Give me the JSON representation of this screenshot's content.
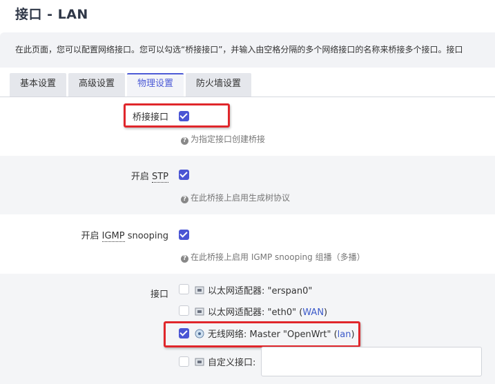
{
  "page": {
    "title": "接口 - LAN",
    "description": "在此页面，您可以配置网络接口。您可以勾选“桥接接口”，并输入由空格分隔的多个网络接口的名称来桥接多个接口。接口"
  },
  "tabs": [
    {
      "label": "基本设置",
      "active": false
    },
    {
      "label": "高级设置",
      "active": false
    },
    {
      "label": "物理设置",
      "active": true
    },
    {
      "label": "防火墙设置",
      "active": false
    }
  ],
  "fields": {
    "bridge": {
      "label": "桥接接口",
      "checked": true,
      "hint": "为指定接口创建桥接"
    },
    "stp": {
      "label_prefix": "开启 ",
      "abbr": "STP",
      "checked": true,
      "hint": "在此桥接上启用生成树协议"
    },
    "igmp": {
      "label_prefix": "开启 ",
      "abbr": "IGMP",
      "label_suffix": " snooping",
      "checked": true,
      "hint": "在此桥接上启用 IGMP snooping 组播（多播）"
    },
    "interfaces": {
      "label": "接口",
      "options": [
        {
          "text": "以太网适配器: \"erspan0\"",
          "link": "",
          "suffix": "",
          "checked": false
        },
        {
          "text": "以太网适配器: \"eth0\" (",
          "link": "WAN",
          "suffix": ")",
          "checked": false
        },
        {
          "text": "无线网络: Master \"OpenWrt\" (",
          "link": "lan",
          "suffix": ")",
          "checked": true
        },
        {
          "text": "自定义接口:",
          "link": "",
          "suffix": "",
          "checked": false
        }
      ],
      "custom_value": ""
    }
  },
  "colors": {
    "accent": "#4a55d4",
    "highlight": "#e0262b",
    "link": "#3b59c9"
  },
  "icons": {
    "help": "question-circle-icon",
    "ethernet": "ethernet-adapter-icon",
    "wireless": "wireless-network-icon"
  }
}
